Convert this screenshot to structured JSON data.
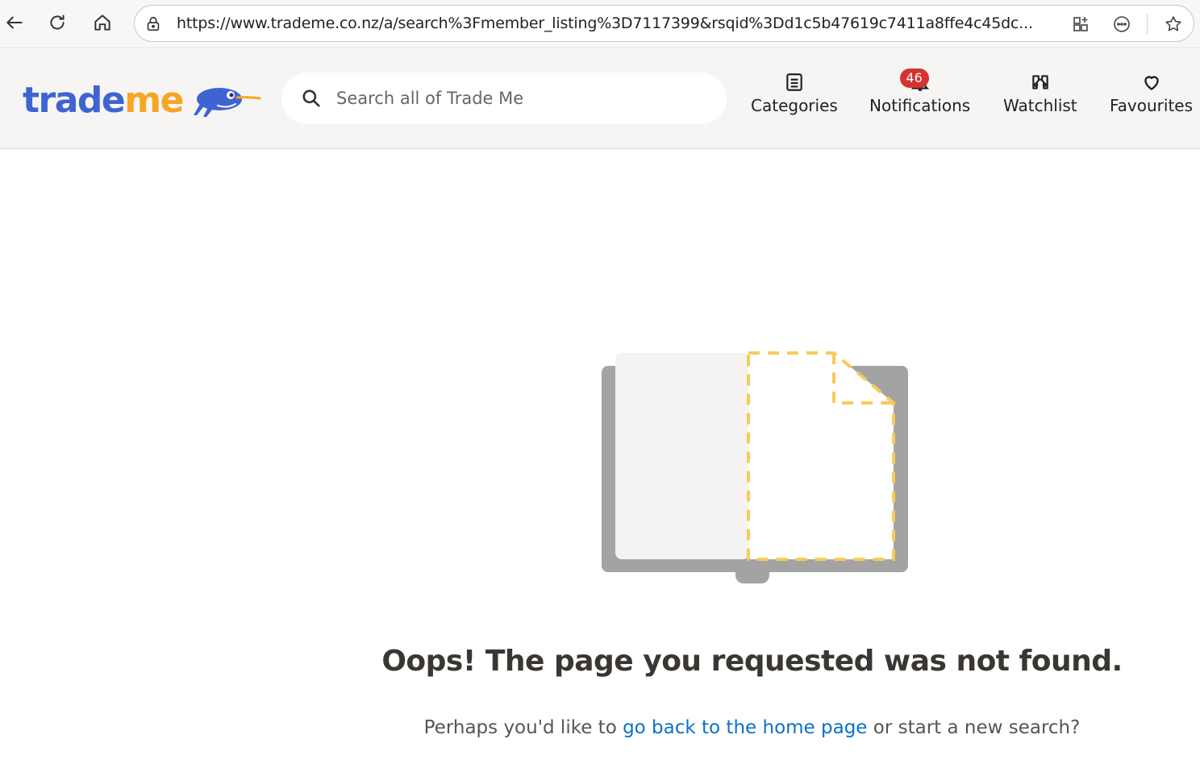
{
  "browser": {
    "url": "https://www.trademe.co.nz/a/search%3Fmember_listing%3D7117399&rsqid%3Dd1c5b47619c7411a8ffe4c45dc..."
  },
  "header": {
    "logo": {
      "part1": "trade",
      "part2": "me"
    },
    "search_placeholder": "Search all of Trade Me",
    "nav": {
      "categories": "Categories",
      "notifications": "Notifications",
      "notifications_count": "46",
      "watchlist": "Watchlist",
      "favourites": "Favourites"
    }
  },
  "main": {
    "title": "Oops! The page you requested was not found.",
    "sub_before": "Perhaps you'd like to ",
    "sub_link": "go back to the home page",
    "sub_after": " or start a new search?"
  },
  "colors": {
    "brand_blue": "#3f63d3",
    "brand_yellow": "#f5a623",
    "badge_red": "#d63230",
    "link_blue": "#0b71c7"
  }
}
